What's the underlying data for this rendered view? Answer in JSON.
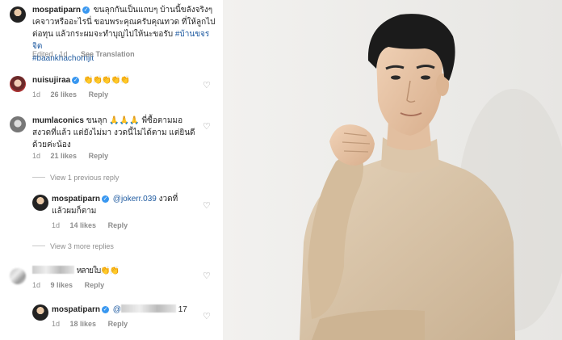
{
  "post": {
    "username": "mospatiparn",
    "caption_line1": "ขนลุกกันเป็นแถบๆ บ้านนี้ขลังจริงๆ",
    "caption_line2": "เคจาวหรืออะไรนี่ ขอบพระคุณครับคุณทวด ที่ให้ลูกไป",
    "caption_line3": "ต่อทุน แล้วกระผมจะทำบุญไปให้นะขอรับ",
    "caption_tag1": "#บ้านขจรจิต",
    "caption_tag2": "#baankhachornjit",
    "edited": "Edited · 1d",
    "see_translation": "See Translation"
  },
  "comments": [
    {
      "username": "nuisujiraa",
      "verified": true,
      "text": "👏👏👏👏👏",
      "time": "1d",
      "likes": "26 likes",
      "reply": "Reply"
    },
    {
      "username": "mumlaconics",
      "verified": false,
      "text_line1": "ขนลุก 🙏🙏🙏  พี่ซื้อตามมอ",
      "text_line2": "สงวดที่แล้ว แต่ยังไม่มา งวดนี้ไม่ได้ตาม แต่ยินดี",
      "text_line3": "ด้วยค่ะน้อง",
      "time": "1d",
      "likes": "21 likes",
      "reply": "Reply",
      "view_replies": "View 1 previous reply"
    },
    {
      "username": "mospatiparn",
      "verified": true,
      "mention": "@jokerr.039",
      "text_line1": " งวดที่",
      "text_line2": "แล้วผมก็ตาม",
      "time": "1d",
      "likes": "14 likes",
      "reply": "Reply",
      "view_replies": "View 3 more replies"
    },
    {
      "username": "",
      "text": "หลายใบ👏👏",
      "time": "1d",
      "likes": "9 likes",
      "reply": "Reply"
    },
    {
      "username": "mospatiparn",
      "verified": true,
      "mention": "@",
      "text": "17",
      "time": "1d",
      "likes": "18 likes",
      "reply": "Reply"
    }
  ],
  "icons": {
    "heart": "heart-icon",
    "verified": "verified-badge-icon"
  },
  "colors": {
    "link": "#1e5aa0",
    "verified": "#3897f0",
    "muted": "#8e8e8e",
    "sweater": "#d9c4a9",
    "photo_bg": "#efeeec"
  }
}
